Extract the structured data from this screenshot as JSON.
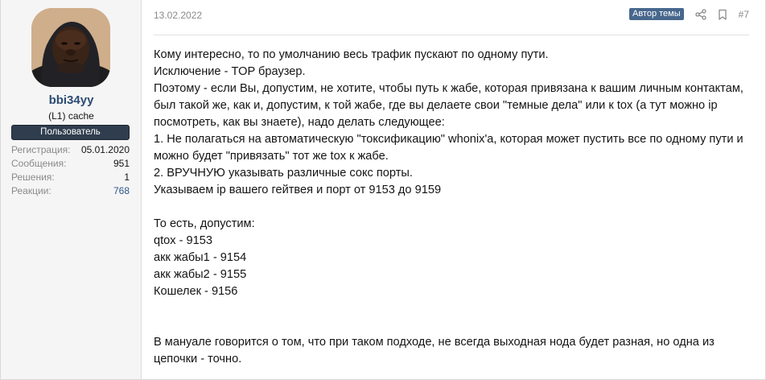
{
  "user": {
    "username": "bbi34yy",
    "user_title": "(L1) cache",
    "banner": "Пользователь",
    "avatar_icon": "user-avatar-photo",
    "stats": [
      {
        "label": "Регистрация:",
        "value": "05.01.2020"
      },
      {
        "label": "Сообщения:",
        "value": "951"
      },
      {
        "label": "Решения:",
        "value": "1"
      },
      {
        "label": "Реакции:",
        "value": "768"
      }
    ]
  },
  "post": {
    "date": "13.02.2022",
    "author_badge": "Автор темы",
    "share_icon": "share-icon",
    "bookmark_icon": "bookmark-icon",
    "number": "#7",
    "lines": [
      "Кому интересно, то по умолчанию весь трафик пускают по одному пути.",
      "Исключение - TOP браузер.",
      "Поэтому - если Вы, допустим, не хотите, чтобы путь к жабе, которая привязана к вашим личным контактам, был такой же, как и, допустим, к той жабе, где вы делаете свои \"темные дела\" или к tox (а тут можно ip посмотреть, как вы знаете), надо делать следующее:",
      "1. Не полагаться на автоматическую \"токсификацию\" whonix'a, которая может пустить все по одному пути и можно будет \"привязать\" тот же tox к жабе.",
      "2. ВРУЧНУЮ указывать различные сокс порты.",
      "Указываем ip вашего гейтвея и порт от 9153 до 9159",
      "",
      "То есть, допустим:",
      "qtox - 9153",
      "акк жабы1 - 9154",
      "акк жабы2 - 9155",
      "Кошелек - 9156",
      "",
      "",
      "В мануале говорится о том, что при таком подходе, не всегда выходная нода будет разная, но одна из цепочки - точно."
    ]
  },
  "colors": {
    "username": "#2b4b73",
    "banner_bg": "#2f3d4e",
    "author_badge_bg": "#47678d",
    "muted_text": "#8a8a8a"
  }
}
